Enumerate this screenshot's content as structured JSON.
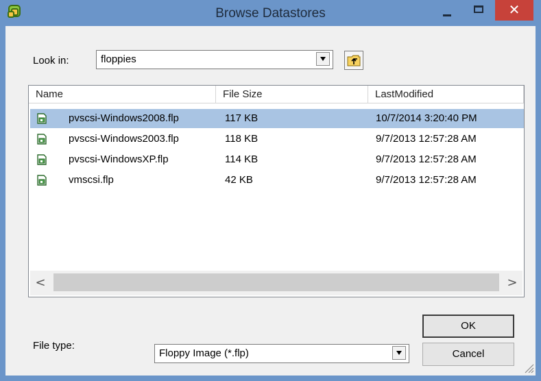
{
  "window": {
    "title": "Browse Datastores",
    "close_glyph": "✕"
  },
  "look_in": {
    "label": "Look in:",
    "value": "floppies"
  },
  "columns": {
    "name": "Name",
    "size": "File Size",
    "modified": "LastModified"
  },
  "files": [
    {
      "name": "pvscsi-Windows2008.flp",
      "size": "117 KB",
      "modified": "10/7/2014 3:20:40 PM",
      "selected": true
    },
    {
      "name": "pvscsi-Windows2003.flp",
      "size": "118 KB",
      "modified": "9/7/2013 12:57:28 AM"
    },
    {
      "name": "pvscsi-WindowsXP.flp",
      "size": "114 KB",
      "modified": "9/7/2013 12:57:28 AM"
    },
    {
      "name": "vmscsi.flp",
      "size": "42 KB",
      "modified": "9/7/2013 12:57:28 AM"
    }
  ],
  "scroll": {
    "left": "<",
    "right": ">"
  },
  "file_type": {
    "label": "File type:",
    "value": "Floppy Image (*.flp)"
  },
  "buttons": {
    "ok": "OK",
    "cancel": "Cancel"
  },
  "colors": {
    "titlebar": "#6b95c9",
    "close": "#c7423a",
    "selection": "#a9c4e3"
  },
  "icons": {
    "app": "vsphere-logo-icon",
    "folder_up": "folder-up-icon",
    "file": "floppy-file-icon"
  }
}
